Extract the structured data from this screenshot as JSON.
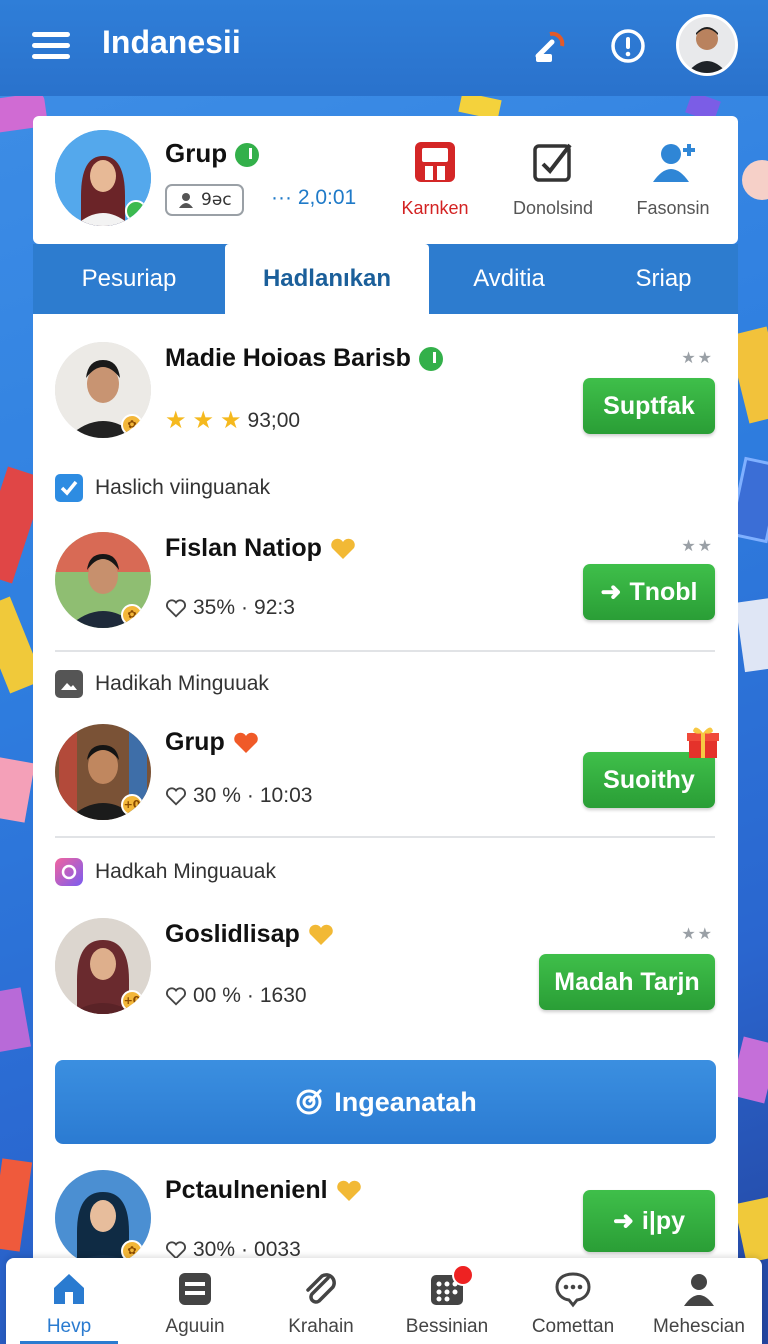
{
  "app": {
    "title": "Indanesii"
  },
  "profile": {
    "name": "Grup",
    "chip_value": "9ǝc",
    "stat_text": "··· 2,0:01"
  },
  "quick_actions": [
    {
      "label": "Karnken",
      "icon": "save-icon",
      "color": "#d32222"
    },
    {
      "label": "Donolsind",
      "icon": "edit-checkbox-icon"
    },
    {
      "label": "Fasonsin",
      "icon": "add-user-icon"
    }
  ],
  "tabs": [
    {
      "label": "Pesuriap"
    },
    {
      "label": "Hadlanıkan",
      "active": true
    },
    {
      "label": "Avditia"
    },
    {
      "label": "Sriap"
    }
  ],
  "entries": [
    {
      "name": "Madie Hoioas Barisb",
      "meta": "93;00",
      "rating": 3,
      "button": "Suptfak",
      "dots": "★★"
    },
    {
      "section": "Haslich viinguanak",
      "name": "Fislan Natiop",
      "percent": "35%",
      "meta": "92:3",
      "button": "Tnobl",
      "dots": "★★"
    },
    {
      "section": "Hadikah Minguuak",
      "name": "Grup",
      "percent": "30 %",
      "meta": "10:03",
      "button": "Suoithy"
    },
    {
      "section": "Hadkah Minguauak",
      "name": "Goslidlisap",
      "percent": "00 %",
      "meta": "1630",
      "button": "Madah Tarjn",
      "dots": "★★"
    },
    {
      "name": "Pctaulnenienl",
      "percent": "30%",
      "meta": "0033",
      "button": "i|py"
    }
  ],
  "big_button": {
    "label": "Ingeanatah"
  },
  "bottom_nav": [
    {
      "label": "Hevp",
      "icon": "home-icon",
      "active": true
    },
    {
      "label": "Aguuin",
      "icon": "list-card-icon"
    },
    {
      "label": "Krahain",
      "icon": "paperclip-icon"
    },
    {
      "label": "Bessinian",
      "icon": "grid-dots-icon",
      "badge": true
    },
    {
      "label": "Comettan",
      "icon": "chat-bubble-icon"
    },
    {
      "label": "Mehescian",
      "icon": "person-icon"
    }
  ],
  "colors": {
    "accent": "#2a7bd0",
    "green_button": "#33ab3f",
    "brand_red": "#d32222"
  }
}
